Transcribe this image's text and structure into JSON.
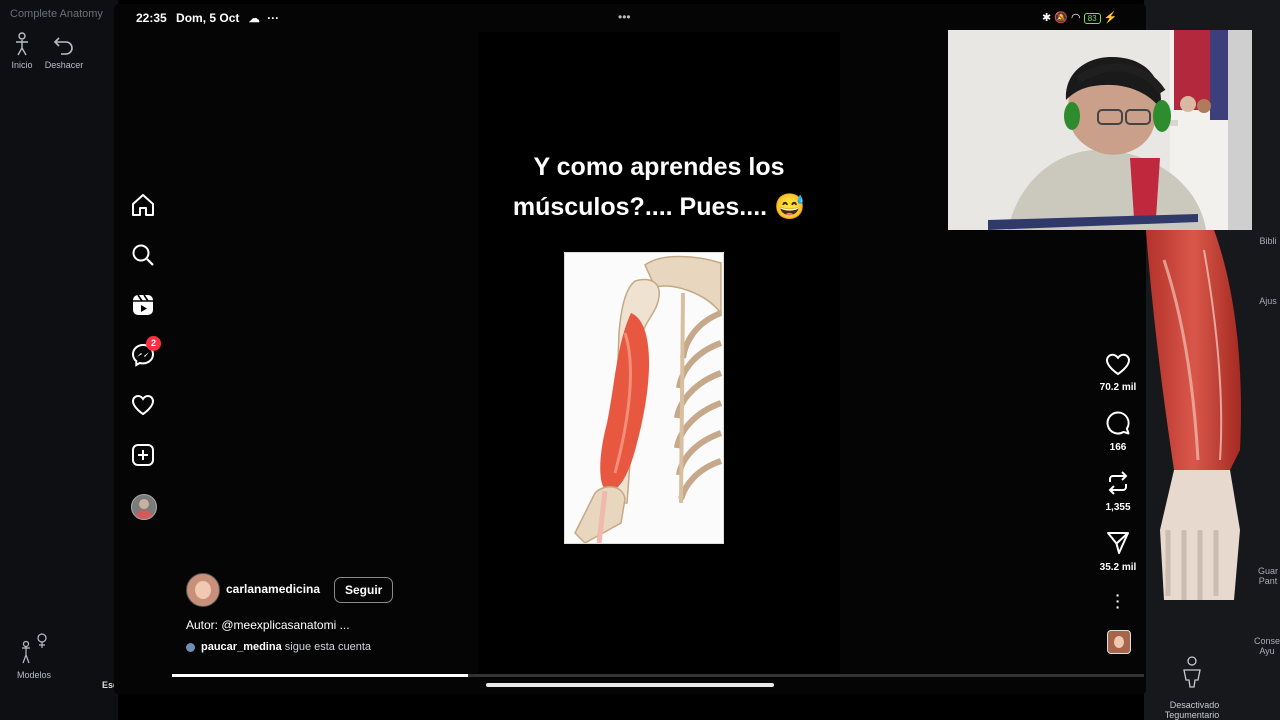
{
  "bg_app": {
    "title": "Complete Anatomy",
    "left_buttons": [
      {
        "label": "Inicio",
        "icon": "person-icon"
      },
      {
        "label": "Deshacer",
        "icon": "undo-icon"
      }
    ],
    "bottom_left": {
      "models_label": "Modelos",
      "esq_label": "Esq"
    },
    "right_panel": {
      "labels": [
        "Bibli",
        "Ajus",
        "Guar\nPant",
        "Conse\nAyu"
      ],
      "toggle_label": "Desactivado\nTegumentario"
    }
  },
  "status_bar": {
    "time": "22:35",
    "date": "Dom, 5 Oct",
    "more": "•••",
    "battery": "83"
  },
  "sidebar": {
    "items": [
      {
        "icon": "home-icon"
      },
      {
        "icon": "search-icon"
      },
      {
        "icon": "reels-icon"
      },
      {
        "icon": "messenger-icon",
        "badge": "2"
      },
      {
        "icon": "heart-icon"
      },
      {
        "icon": "create-icon"
      },
      {
        "icon": "profile-avatar"
      }
    ]
  },
  "reel": {
    "caption_line1": "Y como aprendes los",
    "caption_line2": "músculos?.... Pues.... 😅",
    "author": {
      "username": "carlanamedicina",
      "follow_label": "Seguir",
      "description": "Autor: @meexplicasanatomi ...",
      "follower_user": "paucar_medina",
      "follower_text": " sigue esta cuenta"
    },
    "actions": {
      "likes": "70.2 mil",
      "comments": "166",
      "reposts": "1,355",
      "shares": "35.2 mil"
    },
    "progress": 0.305
  },
  "colors": {
    "accent_badge": "#ff3040",
    "background": "#000000",
    "muscle": "#e8573f"
  }
}
